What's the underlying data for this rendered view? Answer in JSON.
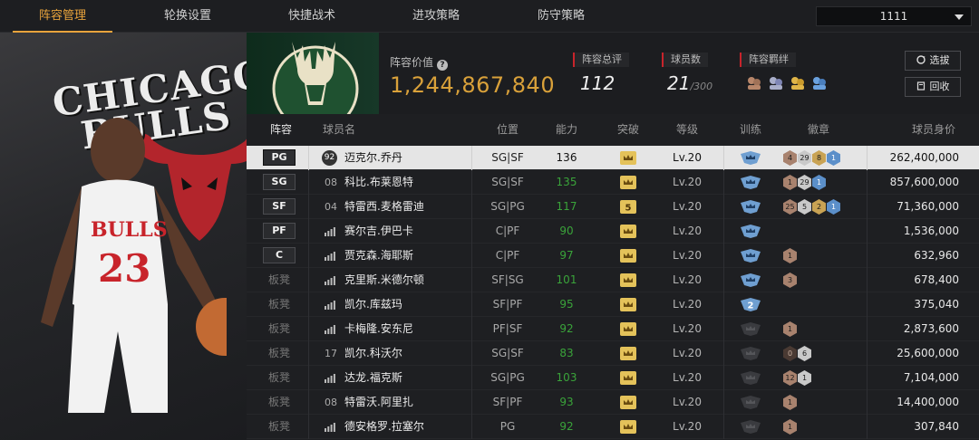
{
  "nav": {
    "tabs": [
      "阵容管理",
      "轮换设置",
      "快捷战术",
      "进攻策略",
      "防守策略"
    ],
    "active_index": 0,
    "selector_value": "1111"
  },
  "art": {
    "wordmark_line1": "CHICAGO",
    "wordmark_line2": "BULLS",
    "jersey_text": "BULLS",
    "jersey_number": "23"
  },
  "header": {
    "lineup_value_label": "阵容价值",
    "lineup_value": "1,244,867,840",
    "total_rating_label": "阵容总评",
    "total_rating": "112",
    "player_count_label": "球员数",
    "player_count": "21",
    "player_count_max": "/300",
    "bond_label": "阵容羁绊",
    "pick_button": "选拔",
    "recycle_button": "回收"
  },
  "table": {
    "headers": [
      "阵容",
      "球员名",
      "位置",
      "能力",
      "突破",
      "等级",
      "训练",
      "徽章",
      "球员身价"
    ],
    "rows": [
      {
        "slot": "PG",
        "starter": true,
        "num": "92",
        "num_style": "disc",
        "name": "迈克尔.乔丹",
        "pos": "SG|SF",
        "ability": "136",
        "break": "crown",
        "level": "Lv.20",
        "train": "gold",
        "badges": [
          [
            "bronze",
            "4"
          ],
          [
            "silver",
            "29"
          ],
          [
            "gold",
            "8"
          ],
          [
            "blue",
            "1"
          ]
        ],
        "price": "262,400,000",
        "selected": true
      },
      {
        "slot": "SG",
        "starter": true,
        "num": "08",
        "num_style": "text",
        "name": "科比.布莱恩特",
        "pos": "SG|SF",
        "ability": "135",
        "break": "crown",
        "level": "Lv.20",
        "train": "gold",
        "badges": [
          [
            "bronze",
            "1"
          ],
          [
            "silver",
            "29"
          ],
          [
            "blue",
            "1"
          ]
        ],
        "price": "857,600,000"
      },
      {
        "slot": "SF",
        "starter": true,
        "num": "04",
        "num_style": "text",
        "name": "特雷西.麦格雷迪",
        "pos": "SG|PG",
        "ability": "117",
        "break": "5",
        "level": "Lv.20",
        "train": "gold",
        "badges": [
          [
            "bronze",
            "25"
          ],
          [
            "silver",
            "5"
          ],
          [
            "gold",
            "2"
          ],
          [
            "blue",
            "1"
          ]
        ],
        "price": "71,360,000"
      },
      {
        "slot": "PF",
        "starter": true,
        "num": "",
        "num_style": "signal",
        "name": "赛尔吉.伊巴卡",
        "pos": "C|PF",
        "ability": "90",
        "break": "crown",
        "level": "Lv.20",
        "train": "gold",
        "badges": [],
        "price": "1,536,000"
      },
      {
        "slot": "C",
        "starter": true,
        "num": "",
        "num_style": "signal",
        "name": "贾克森.海耶斯",
        "pos": "C|PF",
        "ability": "97",
        "break": "crown",
        "level": "Lv.20",
        "train": "gold",
        "badges": [
          [
            "bronze",
            "1"
          ]
        ],
        "price": "632,960"
      },
      {
        "slot": "板凳",
        "starter": false,
        "num": "",
        "num_style": "signal",
        "name": "克里斯.米德尔顿",
        "pos": "SF|SG",
        "ability": "101",
        "break": "crown",
        "level": "Lv.20",
        "train": "gold",
        "badges": [
          [
            "bronze",
            "3"
          ]
        ],
        "price": "678,400"
      },
      {
        "slot": "板凳",
        "starter": false,
        "num": "",
        "num_style": "signal",
        "name": "凯尔.库兹玛",
        "pos": "SF|PF",
        "ability": "95",
        "break": "crown",
        "level": "Lv.20",
        "train": "2",
        "badges": [],
        "price": "375,040"
      },
      {
        "slot": "板凳",
        "starter": false,
        "num": "",
        "num_style": "signal",
        "name": "卡梅隆.安东尼",
        "pos": "PF|SF",
        "ability": "92",
        "break": "crown",
        "level": "Lv.20",
        "train": "grey",
        "badges": [
          [
            "bronze",
            "1"
          ]
        ],
        "price": "2,873,600"
      },
      {
        "slot": "板凳",
        "starter": false,
        "num": "17",
        "num_style": "text",
        "name": "凯尔.科沃尔",
        "pos": "SG|SF",
        "ability": "83",
        "break": "crown",
        "level": "Lv.20",
        "train": "grey",
        "badges": [
          [
            "dark",
            "0"
          ],
          [
            "silver",
            "6"
          ]
        ],
        "price": "25,600,000"
      },
      {
        "slot": "板凳",
        "starter": false,
        "num": "",
        "num_style": "signal",
        "name": "达龙.福克斯",
        "pos": "SG|PG",
        "ability": "103",
        "break": "crown",
        "level": "Lv.20",
        "train": "grey",
        "badges": [
          [
            "bronze",
            "12"
          ],
          [
            "silver",
            "1"
          ]
        ],
        "price": "7,104,000"
      },
      {
        "slot": "板凳",
        "starter": false,
        "num": "08",
        "num_style": "text",
        "name": "特雷沃.阿里扎",
        "pos": "SF|PF",
        "ability": "93",
        "break": "crown",
        "level": "Lv.20",
        "train": "grey",
        "badges": [
          [
            "bronze",
            "1"
          ]
        ],
        "price": "14,400,000"
      },
      {
        "slot": "板凳",
        "starter": false,
        "num": "",
        "num_style": "signal",
        "name": "德安格罗.拉塞尔",
        "pos": "PG",
        "ability": "92",
        "break": "crown",
        "level": "Lv.20",
        "train": "grey",
        "badges": [
          [
            "bronze",
            "1"
          ]
        ],
        "price": "307,840"
      }
    ]
  },
  "colors": {
    "accent": "#e8a33c",
    "ability_green": "#3aa33a",
    "flag_red": "#c8242b"
  }
}
